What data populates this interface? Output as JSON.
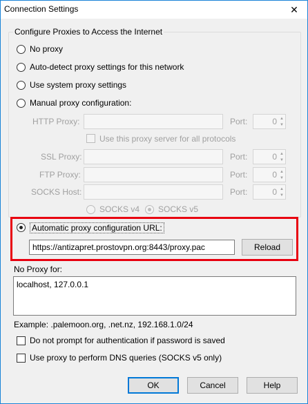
{
  "window": {
    "title": "Connection Settings",
    "close_glyph": "✕"
  },
  "group": {
    "legend": "Configure Proxies to Access the Internet"
  },
  "options": {
    "no_proxy": "No proxy",
    "auto_detect": "Auto-detect proxy settings for this network",
    "system": "Use system proxy settings",
    "manual": "Manual proxy configuration:"
  },
  "manual": {
    "http_label": "HTTP Proxy:",
    "ssl_label": "SSL Proxy:",
    "ftp_label": "FTP Proxy:",
    "socks_label": "SOCKS Host:",
    "port_label": "Port:",
    "http_port": "0",
    "ssl_port": "0",
    "ftp_port": "0",
    "socks_port": "0",
    "same_proxy_label": "Use this proxy server for all protocols",
    "socks_v4": "SOCKS v4",
    "socks_v5": "SOCKS v5"
  },
  "auto_config": {
    "label": "Automatic proxy configuration URL:",
    "url": "https://antizapret.prostovpn.org:8443/proxy.pac",
    "reload": "Reload"
  },
  "no_proxy_for": {
    "label": "No Proxy for:",
    "value": "localhost, 127.0.0.1",
    "example": "Example: .palemoon.org, .net.nz, 192.168.1.0/24"
  },
  "checkboxes": {
    "no_auth_prompt": "Do not prompt for authentication if password is saved",
    "dns_socks": "Use proxy to perform DNS queries (SOCKS v5 only)"
  },
  "buttons": {
    "ok": "OK",
    "cancel": "Cancel",
    "help": "Help"
  },
  "colors": {
    "highlight": "#e8000f",
    "accent": "#0078d7",
    "window_border": "#1883d7"
  },
  "icons": {
    "close": "close-icon",
    "spin_up": "▲",
    "spin_down": "▼"
  }
}
